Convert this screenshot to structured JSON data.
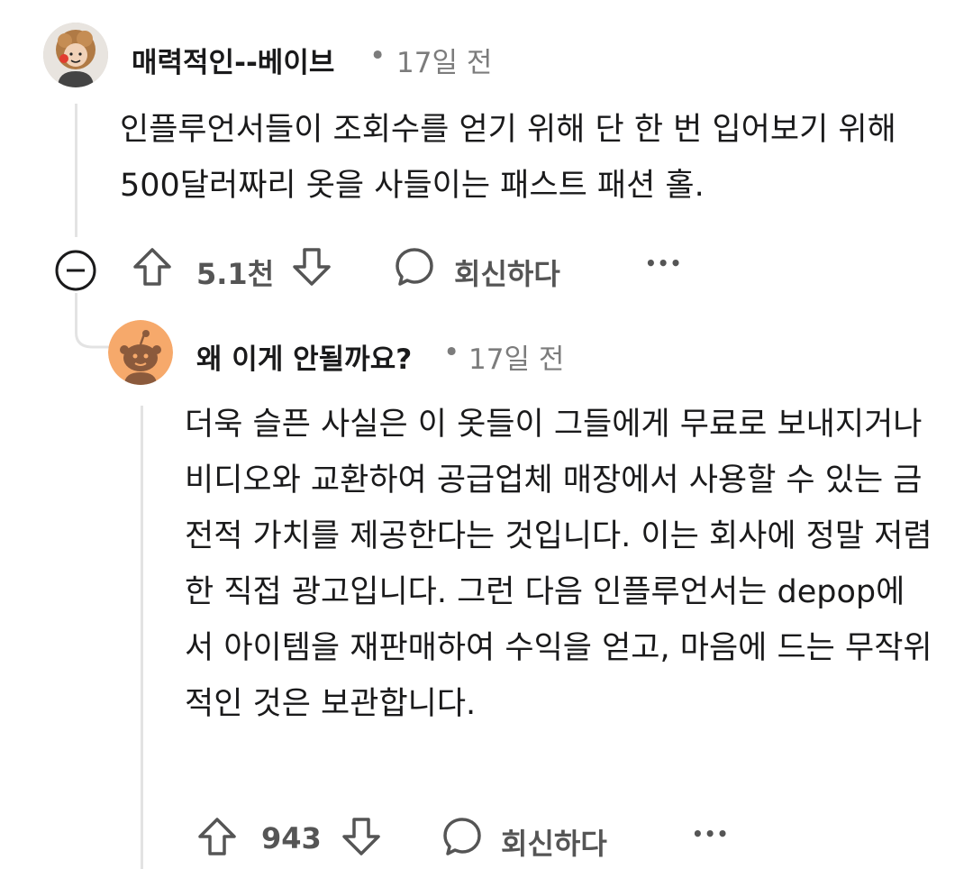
{
  "comments": [
    {
      "username": "매력적인--베이브",
      "time": "17일 전",
      "body": "인플루언서들이 조회수를 얻기 위해 단 한 번 입어보기 위해 500달러짜리 옷을 사들이는 패스트 패션 홀.",
      "votes": "5.1천",
      "reply_label": "회신하다",
      "more_label": "•••",
      "avatar_icon": "user-avatar-icon",
      "collapse_icon": "collapse-minus-icon"
    },
    {
      "username": "왜 이게 안될까요?",
      "time": "17일 전",
      "body": "더욱 슬픈 사실은 이 옷들이 그들에게 무료로 보내지거나 비디오와 교환하여 공급업체 매장에서 사용할 수 있는 금전적 가치를 제공한다는 것입니다. 이는 회사에 정말 저렴한 직접 광고입니다. 그런 다음 인플루언서는 depop에서 아이템을 재판매하여 수익을 얻고, 마음에 드는 무작위적인 것은 보관합니다.",
      "votes": "943",
      "reply_label": "회신하다",
      "more_label": "•••",
      "avatar_icon": "snoo-avatar-icon"
    }
  ],
  "separator": "•",
  "colors": {
    "text": "#1a1a1b",
    "meta": "#7c7c7c",
    "action": "#555555",
    "thread_line": "#e3e3e3",
    "snoo_bg": "#f6a96b",
    "snoo_body": "#8b5a3c"
  }
}
